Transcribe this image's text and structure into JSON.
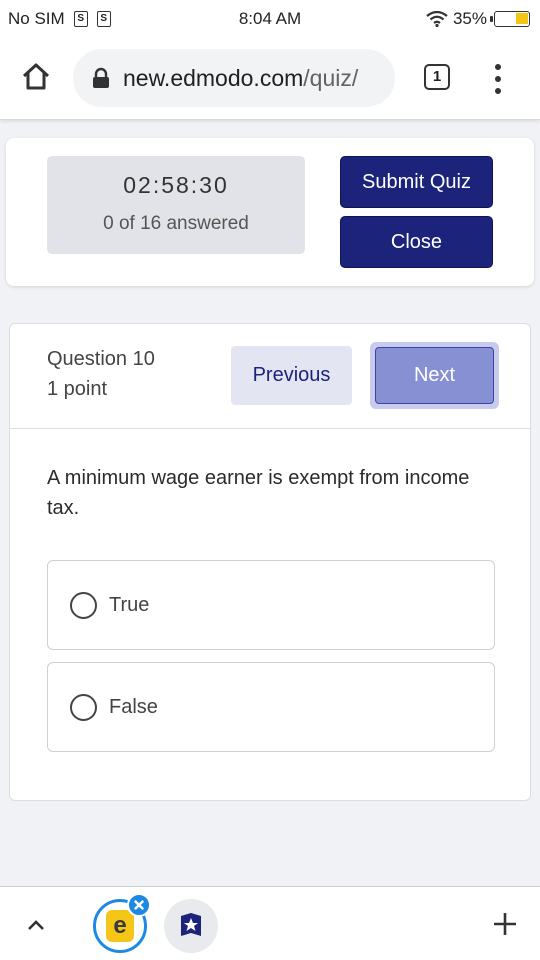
{
  "status_bar": {
    "carrier": "No SIM",
    "sim_icon_glyph": "S",
    "time": "8:04 AM",
    "battery": "35%",
    "battery_color": "#f3c515"
  },
  "browser": {
    "url_domain": "new.edmodo.com",
    "url_path": "/quiz/",
    "tab_count": "1",
    "icons": [
      "home-icon",
      "lock-icon",
      "tabs-icon",
      "more-vert-icon"
    ]
  },
  "quiz_header": {
    "timer": "02:58:30",
    "answered": "0 of 16 answered",
    "submit_label": "Submit Quiz",
    "close_label": "Close"
  },
  "question": {
    "number_label": "Question 10",
    "points_label": "1 point",
    "previous_label": "Previous",
    "next_label": "Next",
    "text": "A minimum wage earner is exempt from income tax.",
    "options": [
      {
        "label": "True",
        "selected": false
      },
      {
        "label": "False",
        "selected": false
      }
    ]
  },
  "bottom_bar": {
    "edmodo_glyph": "e",
    "icons": [
      "chevron-up-icon",
      "edmodo-app-icon",
      "close-icon",
      "star-badge-icon",
      "plus-icon"
    ]
  },
  "colors": {
    "brand_dark": "#1b237b",
    "next_fill": "#8790d3",
    "previous_fill": "#e3e5f3",
    "page_bg": "#f1f2f6"
  }
}
